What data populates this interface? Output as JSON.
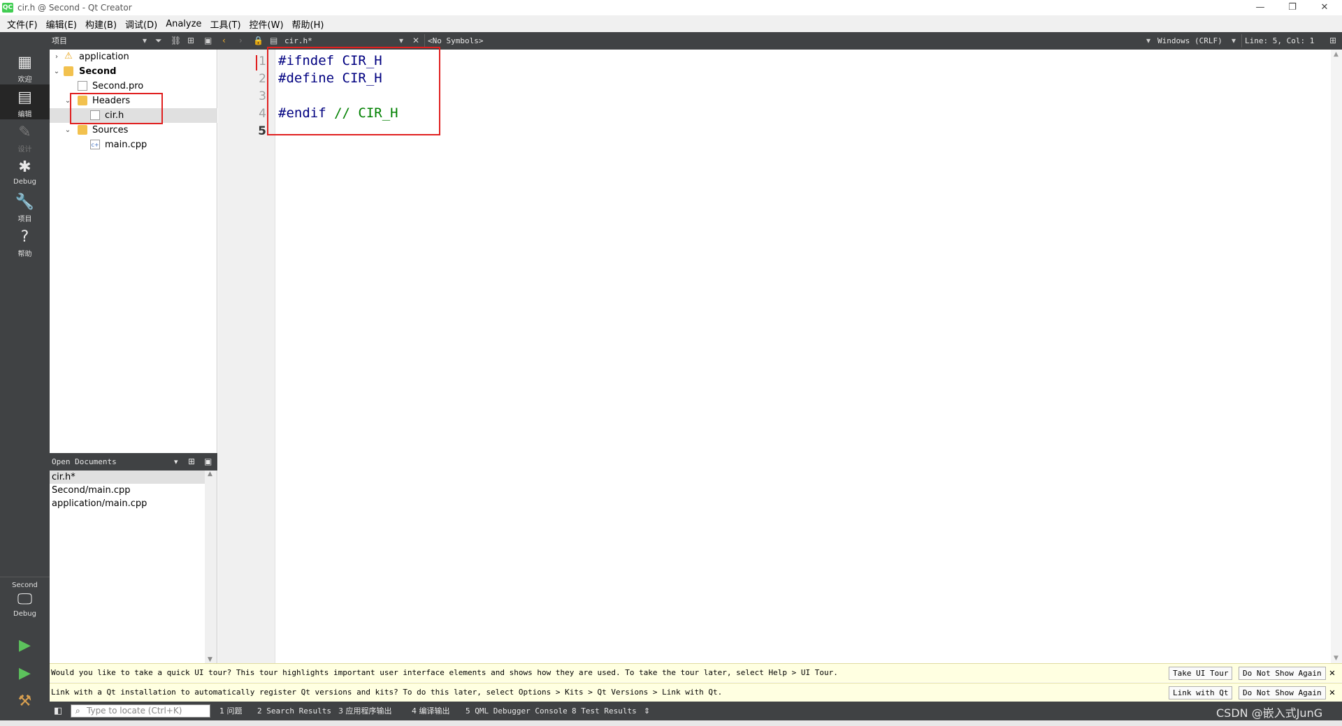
{
  "window": {
    "title": "cir.h @ Second - Qt Creator",
    "icon_text": "QC",
    "controls": [
      "—",
      "❐",
      "✕"
    ]
  },
  "menu": [
    "文件(F)",
    "编辑(E)",
    "构建(B)",
    "调试(D)",
    "Analyze",
    "工具(T)",
    "控件(W)",
    "帮助(H)"
  ],
  "toolbar": {
    "pane_title": "项目",
    "file_tab": "cir.h*",
    "symbols": "<No Symbols>",
    "line_ending": "Windows (CRLF)",
    "position": "Line: 5, Col: 1"
  },
  "modes": [
    {
      "label": "欢迎",
      "icon": "grid-icon"
    },
    {
      "label": "编辑",
      "icon": "edit-icon"
    },
    {
      "label": "设计",
      "icon": "pencil-icon"
    },
    {
      "label": "Debug",
      "icon": "bug-icon"
    },
    {
      "label": "项目",
      "icon": "wrench-icon"
    },
    {
      "label": "帮助",
      "icon": "help-icon"
    }
  ],
  "kit": {
    "project": "Second",
    "config": "Debug"
  },
  "tree": [
    {
      "label": "application",
      "icon": "warning-icon"
    },
    {
      "label": "Second",
      "icon": "project-icon"
    },
    {
      "label": "Second.pro",
      "icon": "pro-file-icon"
    },
    {
      "label": "Headers",
      "icon": "folder-icon"
    },
    {
      "label": "cir.h",
      "icon": "header-file-icon"
    },
    {
      "label": "Sources",
      "icon": "folder-icon"
    },
    {
      "label": "main.cpp",
      "icon": "cpp-file-icon"
    }
  ],
  "open_documents": {
    "title": "Open Documents",
    "items": [
      "cir.h*",
      "Second/main.cpp",
      "application/main.cpp"
    ]
  },
  "editor": {
    "line_numbers": [
      "1",
      "2",
      "3",
      "4",
      "5"
    ],
    "lines": [
      {
        "kw": "#ifndef CIR_H",
        "cm": ""
      },
      {
        "kw": "#define CIR_H",
        "cm": ""
      },
      {
        "kw": "",
        "cm": ""
      },
      {
        "kw": "#endif ",
        "cm": "// CIR_H"
      },
      {
        "kw": "",
        "cm": ""
      }
    ]
  },
  "infobars": [
    {
      "text": "Would you like to take a quick UI tour? This tour highlights important user interface elements and shows how they are used. To take the tour later, select Help > UI Tour.",
      "button1": "Take UI Tour",
      "button2": "Do Not Show Again"
    },
    {
      "text": "Link with a Qt installation to automatically register Qt versions and kits? To do this later, select Options > Kits > Qt Versions > Link with Qt.",
      "button1": "Link with Qt",
      "button2": "Do Not Show Again"
    }
  ],
  "statusbar": {
    "locator_placeholder": "Type to locate (Ctrl+K)",
    "panes": [
      "1 问题",
      "2 Search Results",
      "3 应用程序输出",
      "4 编译输出",
      "5 QML Debugger Console",
      "8 Test Results"
    ]
  },
  "watermark": "CSDN @嵌入式JunG"
}
